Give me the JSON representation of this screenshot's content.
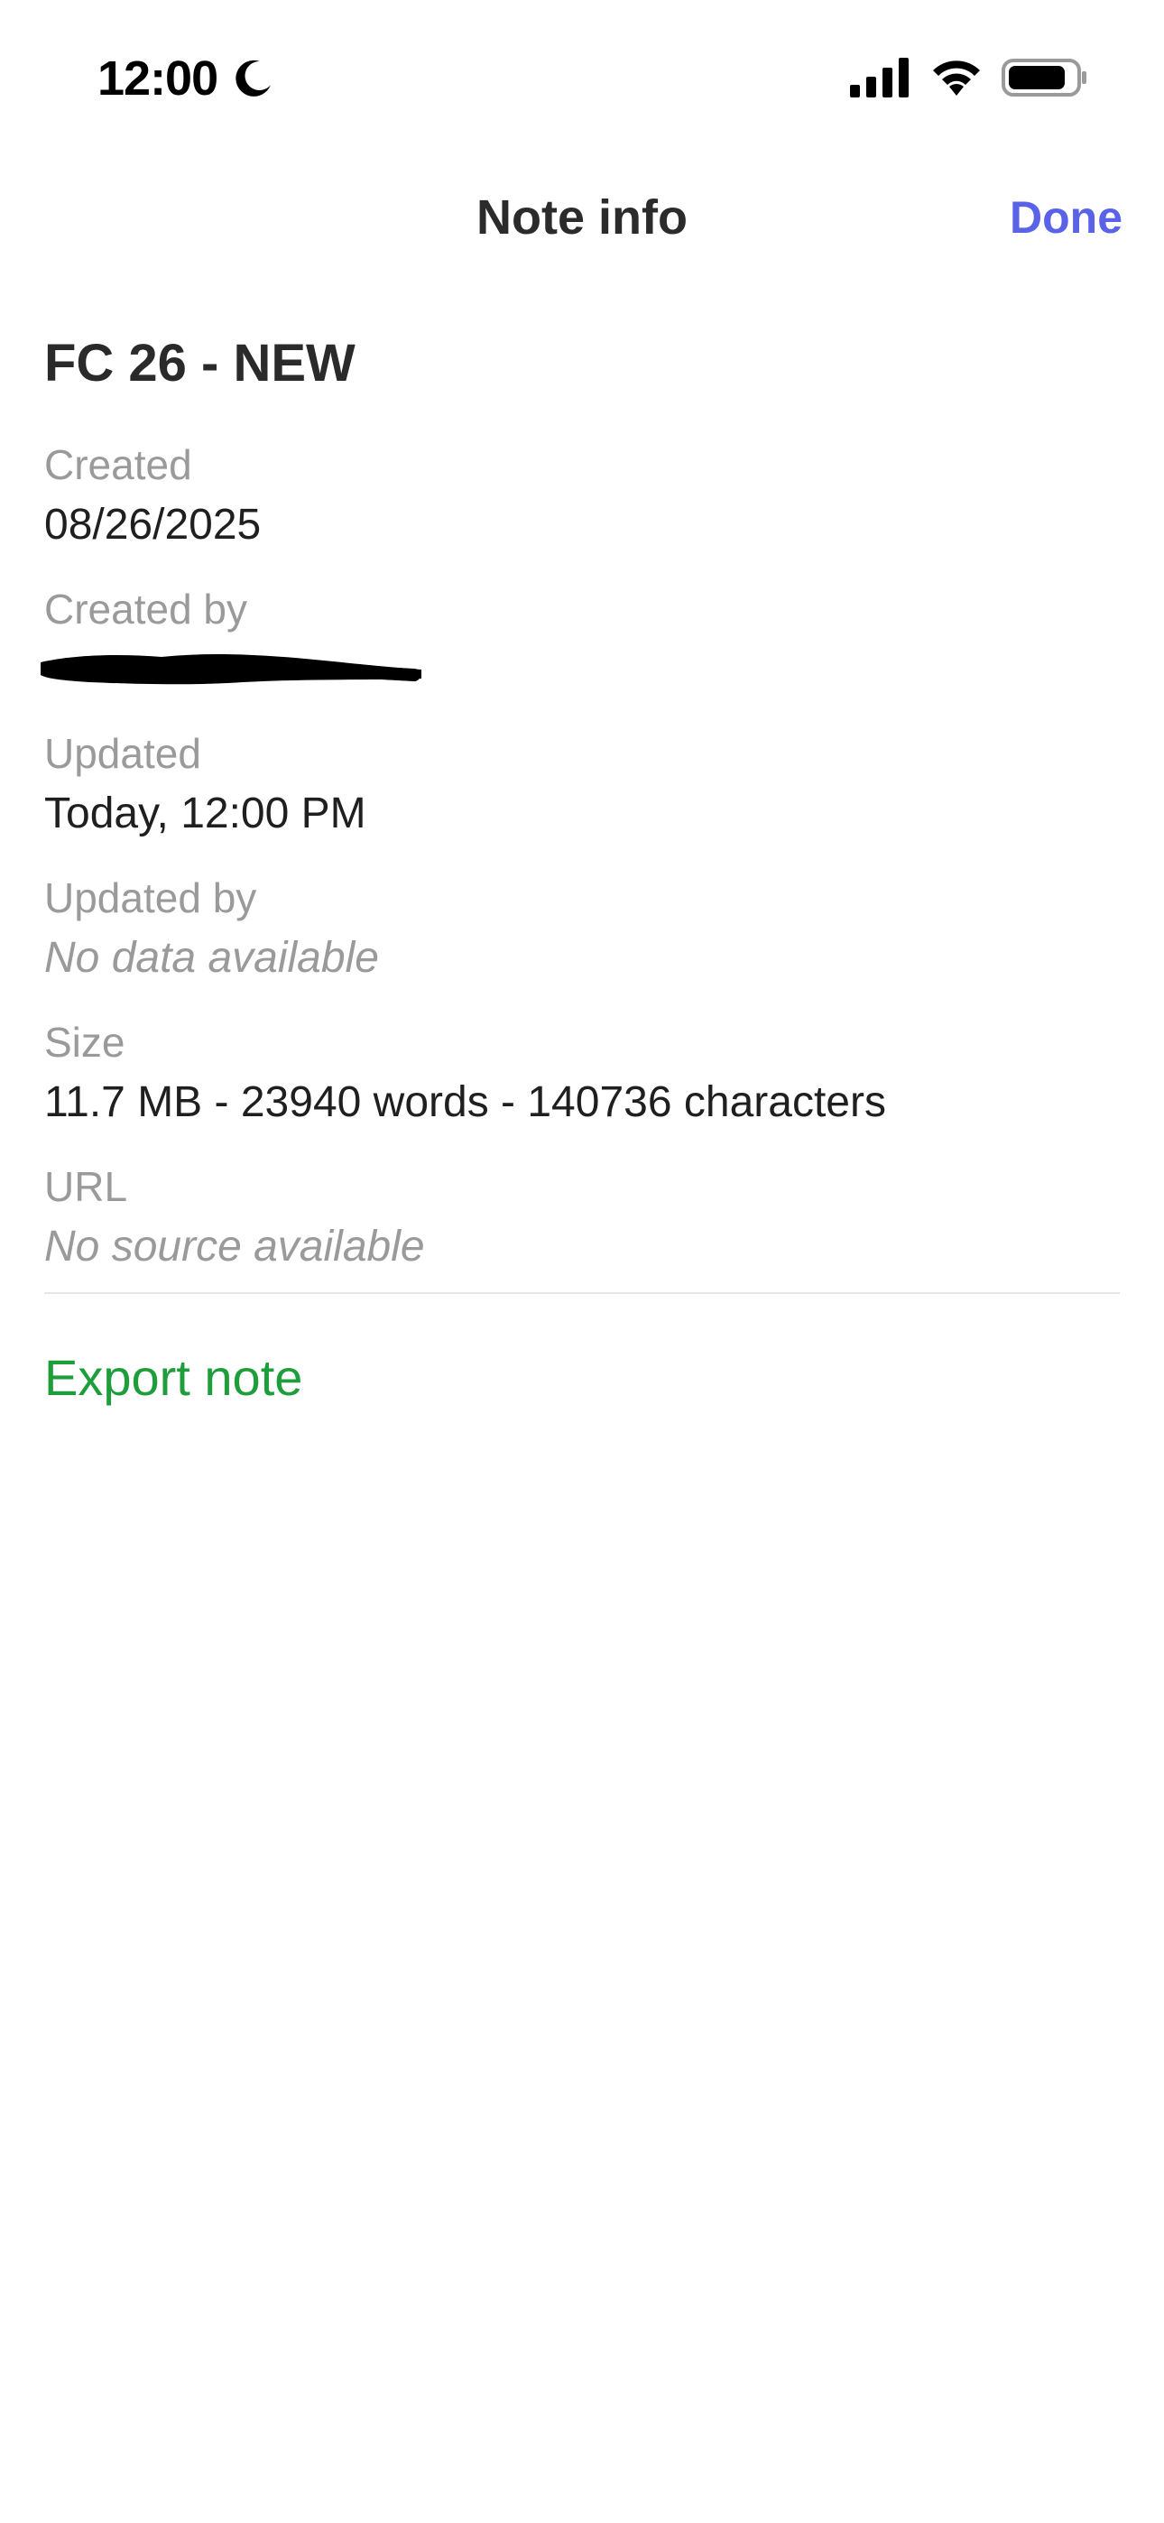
{
  "status_bar": {
    "time": "12:00",
    "icons": [
      "moon-icon",
      "signal-icon",
      "wifi-icon",
      "battery-icon"
    ]
  },
  "nav": {
    "title": "Note info",
    "done_label": "Done",
    "done_color": "#5a63e8"
  },
  "note": {
    "title": "FC 26 - NEW"
  },
  "fields": {
    "created": {
      "label": "Created",
      "value": "08/26/2025"
    },
    "created_by": {
      "label": "Created by",
      "value": ""
    },
    "updated": {
      "label": "Updated",
      "value": "Today, 12:00 PM"
    },
    "updated_by": {
      "label": "Updated by",
      "value": "No data available"
    },
    "size": {
      "label": "Size",
      "value": "11.7 MB - 23940 words - 140736 characters"
    },
    "url": {
      "label": "URL",
      "value": "No source available"
    }
  },
  "actions": {
    "export_label": "Export note",
    "export_color": "#1e9e3b"
  }
}
